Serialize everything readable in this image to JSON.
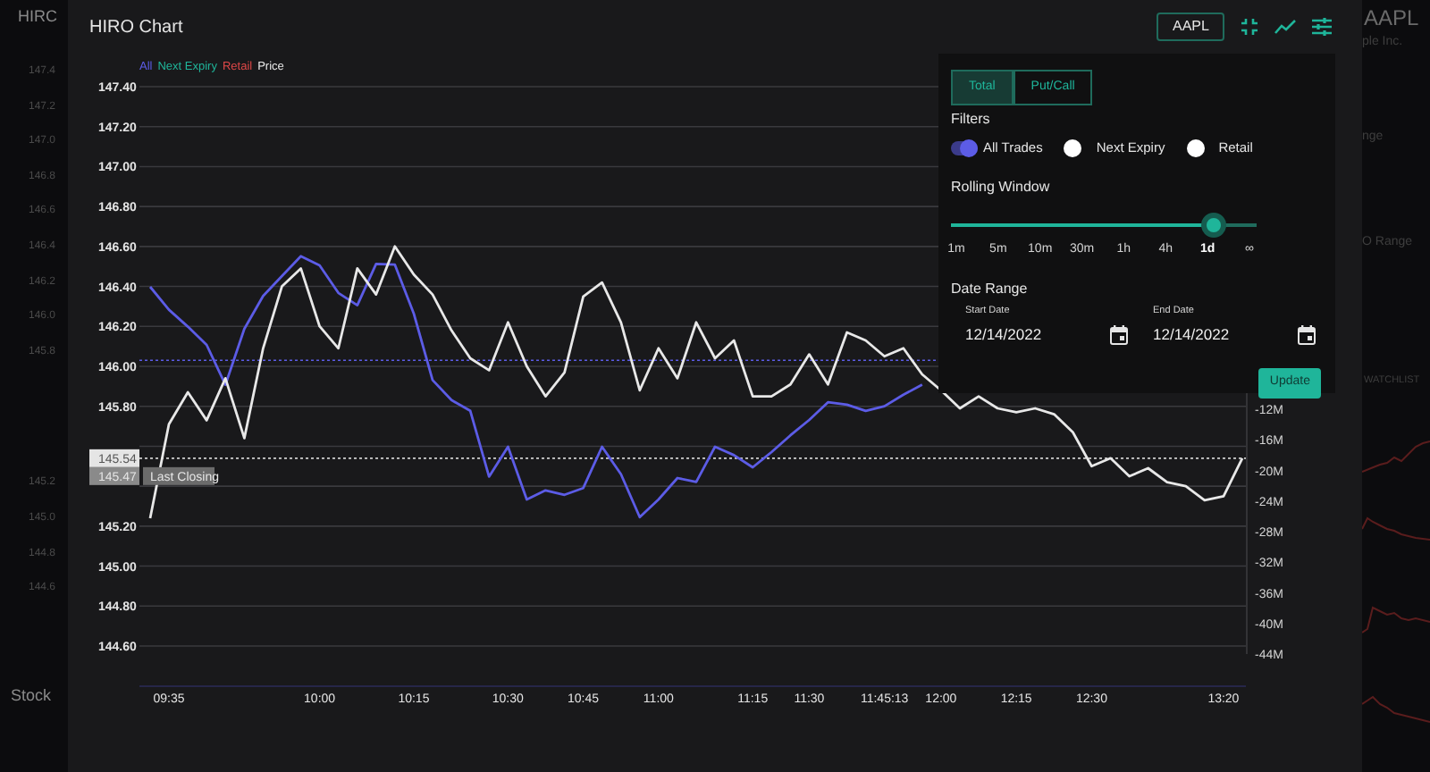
{
  "left_background": {
    "title": "HIRC",
    "axis_labels": [
      "147.4",
      "147.2",
      "147.0",
      "146.8",
      "146.6",
      "146.4",
      "146.2",
      "146.0",
      "145.8",
      "145.2",
      "145.0",
      "144.8",
      "144.6"
    ],
    "footer": "Stock"
  },
  "right_background": {
    "ticker": "AAPL",
    "company": "ple Inc.",
    "label_1": "nge",
    "label_2": "O Range",
    "watchlist": "WATCHLIST"
  },
  "window": {
    "title": "HIRO Chart"
  },
  "toolbar": {
    "symbol": "AAPL"
  },
  "chart": {
    "current_price": {
      "label": "145.54"
    },
    "last_closing": {
      "label": "145.47",
      "caption": "Last Closing"
    },
    "chart_data": {
      "type": "line",
      "ylim": [
        144.6,
        147.4
      ],
      "yticks": [
        {
          "value": 147.4,
          "label": "147.40"
        },
        {
          "value": 147.2,
          "label": "147.20"
        },
        {
          "value": 147.0,
          "label": "147.00"
        },
        {
          "value": 146.8,
          "label": "146.80"
        },
        {
          "value": 146.6,
          "label": "146.60"
        },
        {
          "value": 146.4,
          "label": "146.40"
        },
        {
          "value": 146.2,
          "label": "146.20"
        },
        {
          "value": 146.0,
          "label": "146.00"
        },
        {
          "value": 145.8,
          "label": "145.80"
        },
        {
          "value": 145.2,
          "label": "145.20"
        },
        {
          "value": 145.0,
          "label": "145.00"
        },
        {
          "value": 144.8,
          "label": "144.80"
        },
        {
          "value": 144.6,
          "label": "144.60"
        }
      ],
      "grid": true,
      "y2lim": [
        -44,
        12
      ],
      "y2ticks": [
        {
          "value": -12,
          "label": "-12M"
        },
        {
          "value": -16,
          "label": "-16M"
        },
        {
          "value": -20,
          "label": "-20M"
        },
        {
          "value": -24,
          "label": "-24M"
        },
        {
          "value": -28,
          "label": "-28M"
        },
        {
          "value": -32,
          "label": "-32M"
        },
        {
          "value": -36,
          "label": "-36M"
        },
        {
          "value": -40,
          "label": "-40M"
        },
        {
          "value": -44,
          "label": "-44M"
        }
      ],
      "categories": [
        null,
        "09:35",
        null,
        null,
        null,
        null,
        null,
        null,
        null,
        "10:00",
        null,
        null,
        null,
        null,
        "10:15",
        null,
        null,
        null,
        null,
        "10:30",
        null,
        null,
        null,
        "10:45",
        null,
        null,
        null,
        "11:00",
        null,
        null,
        null,
        null,
        "11:15",
        null,
        null,
        "11:30",
        null,
        null,
        null,
        "11:45:13",
        null,
        null,
        "12:00",
        null,
        null,
        null,
        "12:15",
        null,
        null,
        null,
        "12:30",
        null,
        null,
        null,
        null,
        null,
        null,
        "13:20",
        null
      ],
      "series": [
        {
          "name": "All",
          "color": "#5c5ce6",
          "axis": "y2",
          "values": [
            4.0,
            1.0,
            -1.2,
            -3.6,
            -8.8,
            -1.5,
            2.8,
            5.4,
            8.0,
            6.8,
            3.2,
            1.6,
            7.0,
            6.9,
            0.5,
            -8.2,
            -10.8,
            -12.2,
            -20.8,
            -16.9,
            -23.8,
            -22.6,
            -23.2,
            -22.3,
            -16.9,
            -20.5,
            -26.1,
            -23.8,
            -21.0,
            -21.5,
            -16.9,
            -18.0,
            -19.6,
            -17.6,
            -15.4,
            -13.4,
            -11.1,
            -11.4,
            -12.2,
            -11.6,
            -10.1,
            -8.8,
            null,
            null,
            null,
            null,
            null,
            null,
            null,
            null,
            null,
            null,
            null,
            null,
            null,
            null,
            null,
            null,
            null
          ]
        },
        {
          "name": "Next Expiry",
          "color": "#1fb59a",
          "axis": "y2",
          "values": [
            null,
            null,
            null,
            null,
            null,
            null,
            null,
            null,
            null,
            null,
            null,
            null,
            null,
            null,
            null,
            null,
            null,
            null,
            null,
            null,
            null,
            null,
            null,
            null,
            null,
            null,
            null,
            null,
            null,
            null,
            null,
            null,
            null,
            null,
            null,
            null,
            null,
            null,
            null,
            null,
            null,
            null,
            null,
            null,
            null,
            null,
            null,
            null,
            null,
            null,
            null,
            null,
            null,
            null,
            null,
            null,
            null,
            null,
            null
          ]
        },
        {
          "name": "Retail",
          "color": "#e04848",
          "axis": "y2",
          "values": [
            null,
            null,
            null,
            null,
            null,
            null,
            null,
            null,
            null,
            null,
            null,
            null,
            null,
            null,
            null,
            null,
            null,
            null,
            null,
            null,
            null,
            null,
            null,
            null,
            null,
            null,
            null,
            null,
            null,
            null,
            null,
            null,
            null,
            null,
            null,
            null,
            null,
            null,
            null,
            null,
            null,
            null,
            null,
            null,
            null,
            null,
            null,
            null,
            null,
            null,
            null,
            null,
            null,
            null,
            null,
            null,
            null,
            null,
            null
          ]
        },
        {
          "name": "Price",
          "color": "#e8e8e8",
          "values": [
            145.24,
            145.71,
            145.87,
            145.73,
            145.94,
            145.64,
            146.09,
            146.4,
            146.49,
            146.2,
            146.09,
            146.49,
            146.36,
            146.6,
            146.46,
            146.36,
            146.18,
            146.04,
            145.98,
            146.22,
            146.0,
            145.85,
            145.97,
            146.35,
            146.42,
            146.22,
            145.88,
            146.09,
            145.94,
            146.22,
            146.04,
            146.13,
            145.85,
            145.85,
            145.91,
            146.06,
            145.91,
            146.17,
            146.13,
            146.05,
            146.09,
            145.96,
            145.88,
            145.79,
            145.85,
            145.79,
            145.77,
            145.79,
            145.76,
            145.67,
            145.5,
            145.54,
            145.45,
            145.49,
            145.42,
            145.4,
            145.33,
            145.35,
            145.54
          ]
        }
      ]
    }
  },
  "settings": {
    "tabs": [
      {
        "label": "Total",
        "selected": true
      },
      {
        "label": "Put/Call",
        "selected": false
      }
    ],
    "filters_title": "Filters",
    "filters": [
      {
        "label": "All Trades",
        "on": true
      },
      {
        "label": "Next Expiry",
        "on": false
      },
      {
        "label": "Retail",
        "on": false
      }
    ],
    "rolling_window": {
      "title": "Rolling Window",
      "level": 0.86,
      "stops": [
        {
          "label": "1m",
          "selected": false
        },
        {
          "label": "5m",
          "selected": false
        },
        {
          "label": "10m",
          "selected": false
        },
        {
          "label": "30m",
          "selected": false
        },
        {
          "label": "1h",
          "selected": false
        },
        {
          "label": "4h",
          "selected": false
        },
        {
          "label": "1d",
          "selected": true
        },
        {
          "label": "∞",
          "selected": false
        }
      ]
    },
    "date_range": {
      "title": "Date Range",
      "fields": [
        {
          "label": "Start Date",
          "value": "12/14/2022"
        },
        {
          "label": "End Date",
          "value": "12/14/2022"
        }
      ]
    },
    "update_button": "Update"
  }
}
